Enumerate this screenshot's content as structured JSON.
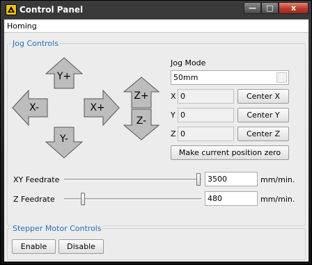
{
  "window": {
    "title": "Control Panel",
    "controls": {
      "minimize": "—",
      "maximize": "□",
      "close": "x"
    }
  },
  "menu": {
    "items": [
      "Homing"
    ]
  },
  "jog": {
    "title": "Jog Controls",
    "arrows": {
      "y_plus": "Y+",
      "y_minus": "Y-",
      "x_minus": "X-",
      "x_plus": "X+",
      "z_plus": "Z+",
      "z_minus": "Z-"
    },
    "mode_label": "Jog Mode",
    "mode_value": "50mm",
    "axes": [
      {
        "label": "X",
        "value": "0",
        "button": "Center X"
      },
      {
        "label": "Y",
        "value": "0",
        "button": "Center Y"
      },
      {
        "label": "Z",
        "value": "0",
        "button": "Center Z"
      }
    ],
    "make_zero_button": "Make current position zero",
    "xy_feedrate": {
      "label": "XY Feedrate",
      "value": "3500",
      "unit": "mm/min."
    },
    "z_feedrate": {
      "label": "Z Feedrate",
      "value": "480",
      "unit": "mm/min."
    }
  },
  "stepper": {
    "title": "Stepper Motor Controls",
    "enable": "Enable",
    "disable": "Disable"
  },
  "colors": {
    "arrow_fill": "#bdbdbd",
    "group_title": "#2a6ebb",
    "close_button": "#c0392b",
    "titlebar": "#1f1f1f"
  }
}
